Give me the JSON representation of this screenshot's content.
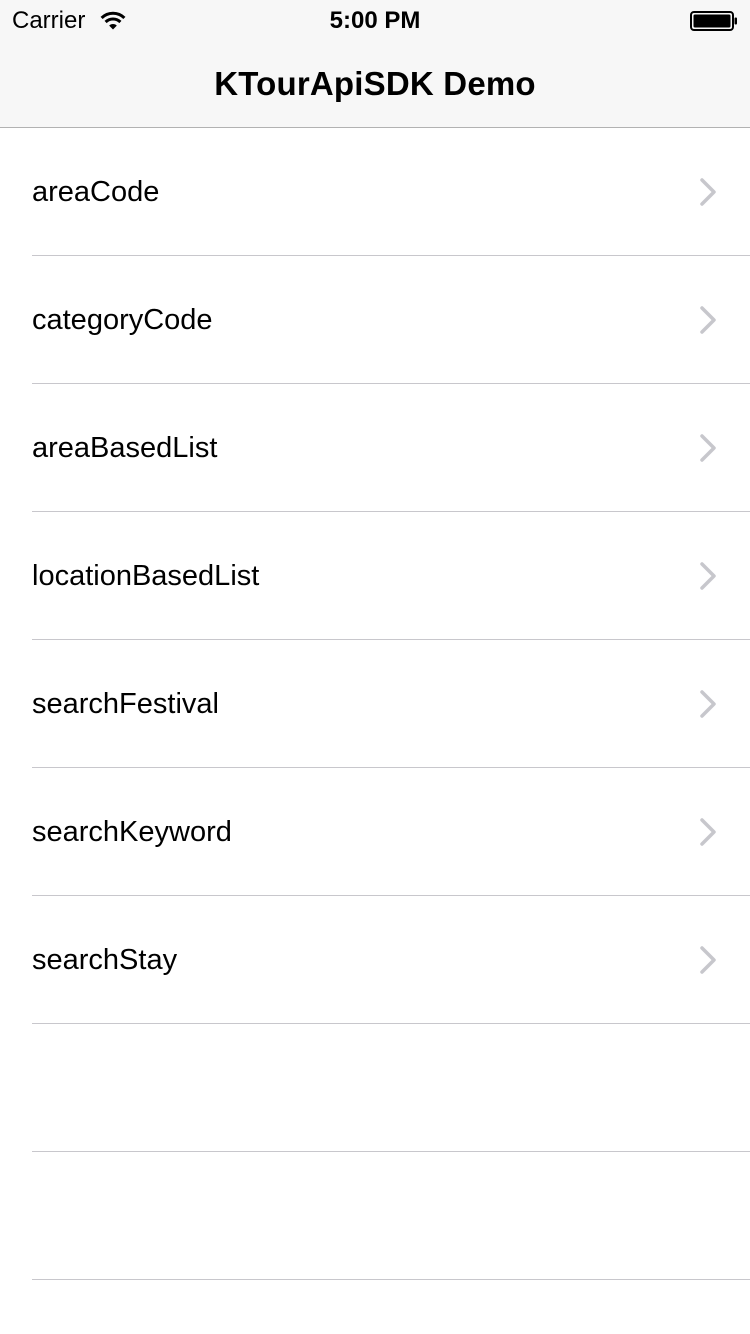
{
  "status_bar": {
    "carrier": "Carrier",
    "time": "5:00 PM",
    "icons": [
      "wifi-icon",
      "battery-icon"
    ]
  },
  "navigation": {
    "title": "KTourApiSDK Demo"
  },
  "list": {
    "items": [
      {
        "label": "areaCode",
        "icon": "chevron-right-icon"
      },
      {
        "label": "categoryCode",
        "icon": "chevron-right-icon"
      },
      {
        "label": "areaBasedList",
        "icon": "chevron-right-icon"
      },
      {
        "label": "locationBasedList",
        "icon": "chevron-right-icon"
      },
      {
        "label": "searchFestival",
        "icon": "chevron-right-icon"
      },
      {
        "label": "searchKeyword",
        "icon": "chevron-right-icon"
      },
      {
        "label": "searchStay",
        "icon": "chevron-right-icon"
      }
    ],
    "empty_rows": 2
  },
  "colors": {
    "navbar_background": "#f7f7f7",
    "separator": "#c8c7cc",
    "chevron": "#c7c7cc",
    "text": "#000000"
  }
}
